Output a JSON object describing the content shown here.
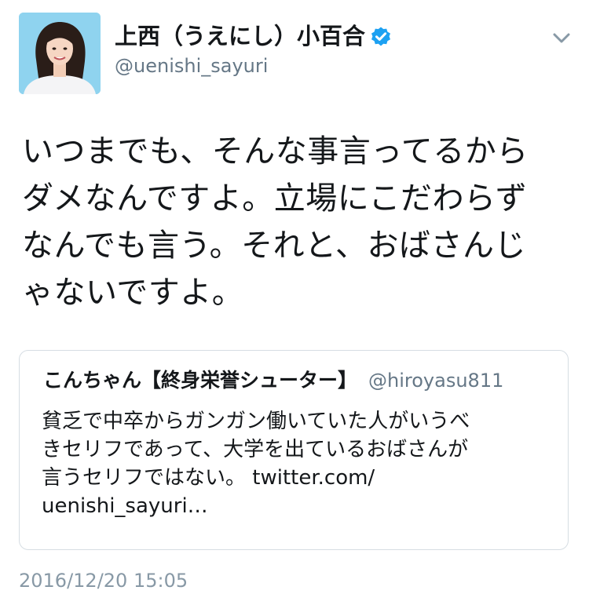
{
  "author": {
    "display_name": "上西（うえにし）小百合",
    "handle": "@uenishi_sayuri",
    "verified": true,
    "avatar_icon": "profile-photo-icon",
    "verified_icon": "verified-badge-icon"
  },
  "menu": {
    "icon": "chevron-down-icon"
  },
  "tweet": {
    "lines": [
      "いつまでも、そんな事言ってるから",
      "ダメなんですよ。立場にこだわらず",
      "なんでも言う。それと、おばさんじ",
      "ゃないですよ。"
    ]
  },
  "quote": {
    "name": "こんちゃん【終身栄誉シューター】",
    "handle": "@hiroyasu811",
    "lines": [
      "貧乏で中卒からガンガン働いていた人がいうべ",
      "きセリフであって、大学を出ているおばさんが",
      "言うセリフではない。 twitter.com/",
      "uenishi_sayuri…"
    ]
  },
  "timestamp": "2016/12/20 15:05",
  "colors": {
    "text_primary": "#14171a",
    "text_secondary": "#657786",
    "timestamp": "#8899a6",
    "verified_blue": "#1da1f2",
    "card_border": "#d6dde3"
  }
}
